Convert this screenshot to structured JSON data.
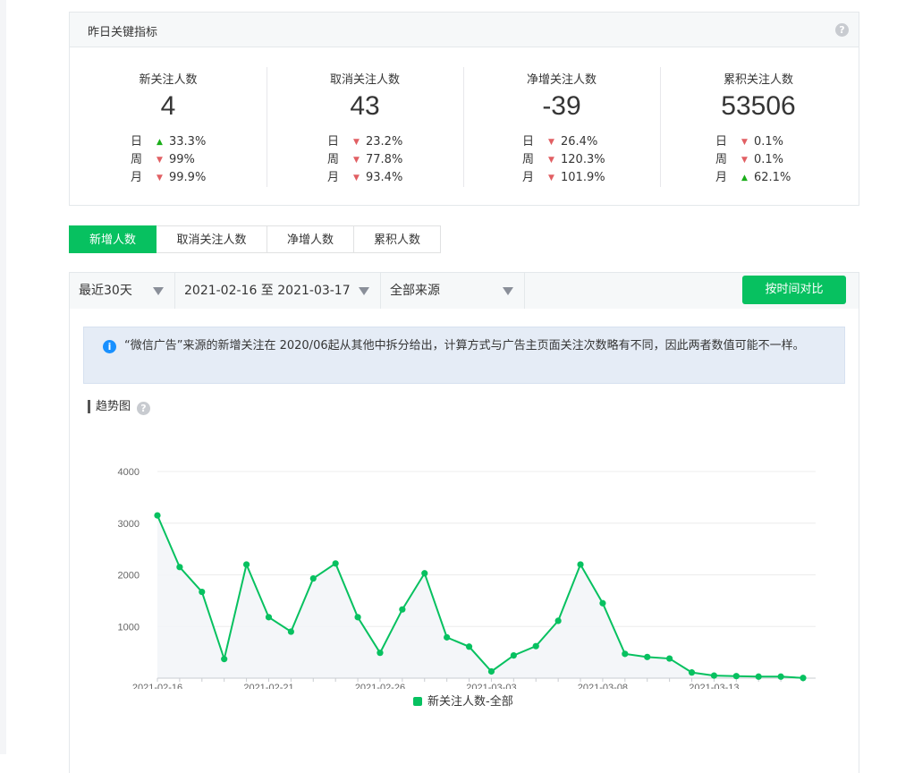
{
  "kpi_panel": {
    "title": "昨日关键指标",
    "help_icon": "?",
    "metrics": [
      {
        "label": "新关注人数",
        "value": "4",
        "rows": [
          {
            "period": "日",
            "dir": "up",
            "pct": "33.3%"
          },
          {
            "period": "周",
            "dir": "down",
            "pct": "99%"
          },
          {
            "period": "月",
            "dir": "down",
            "pct": "99.9%"
          }
        ]
      },
      {
        "label": "取消关注人数",
        "value": "43",
        "rows": [
          {
            "period": "日",
            "dir": "down",
            "pct": "23.2%"
          },
          {
            "period": "周",
            "dir": "down",
            "pct": "77.8%"
          },
          {
            "period": "月",
            "dir": "down",
            "pct": "93.4%"
          }
        ]
      },
      {
        "label": "净增关注人数",
        "value": "-39",
        "rows": [
          {
            "period": "日",
            "dir": "down",
            "pct": "26.4%"
          },
          {
            "period": "周",
            "dir": "down",
            "pct": "120.3%"
          },
          {
            "period": "月",
            "dir": "down",
            "pct": "101.9%"
          }
        ]
      },
      {
        "label": "累积关注人数",
        "value": "53506",
        "rows": [
          {
            "period": "日",
            "dir": "down",
            "pct": "0.1%"
          },
          {
            "period": "周",
            "dir": "down",
            "pct": "0.1%"
          },
          {
            "period": "月",
            "dir": "up",
            "pct": "62.1%"
          }
        ]
      }
    ]
  },
  "tabs": [
    "新增人数",
    "取消关注人数",
    "净增人数",
    "累积人数"
  ],
  "active_tab": 0,
  "filters": {
    "range": "最近30天",
    "dates": "2021-02-16 至 2021-03-17",
    "source": "全部来源",
    "compare_button": "按时间对比"
  },
  "notice": {
    "icon": "i",
    "text": "“微信广告”来源的新增关注在 2020/06起从其他中拆分给出，计算方式与广告主页面关注次数略有不同，因此两者数值可能不一样。"
  },
  "chart_section": {
    "title": "趋势图",
    "help_icon": "?"
  },
  "colors": {
    "accent": "#07c160",
    "up": "#1aad19",
    "down": "#e15f63"
  },
  "chart_data": {
    "type": "line",
    "x": [
      "2021-02-16",
      "2021-02-17",
      "2021-02-18",
      "2021-02-19",
      "2021-02-20",
      "2021-02-21",
      "2021-02-22",
      "2021-02-23",
      "2021-02-24",
      "2021-02-25",
      "2021-02-26",
      "2021-02-27",
      "2021-02-28",
      "2021-03-01",
      "2021-03-02",
      "2021-03-03",
      "2021-03-04",
      "2021-03-05",
      "2021-03-06",
      "2021-03-07",
      "2021-03-08",
      "2021-03-09",
      "2021-03-10",
      "2021-03-11",
      "2021-03-12",
      "2021-03-13",
      "2021-03-14",
      "2021-03-15",
      "2021-03-16",
      "2021-03-17"
    ],
    "x_ticks": [
      "2021-02-16",
      "2021-02-21",
      "2021-02-26",
      "2021-03-03",
      "2021-03-08",
      "2021-03-13"
    ],
    "y_ticks": [
      1000,
      2000,
      3000,
      4000
    ],
    "ylim": [
      0,
      4000
    ],
    "series": [
      {
        "name": "新关注人数-全部",
        "values": [
          3150,
          2150,
          1670,
          370,
          2200,
          1180,
          900,
          1930,
          2220,
          1180,
          490,
          1330,
          2030,
          790,
          610,
          130,
          440,
          620,
          1110,
          2200,
          1450,
          470,
          410,
          380,
          110,
          50,
          40,
          30,
          30,
          4
        ]
      }
    ],
    "grid": true,
    "legend": "bottom"
  }
}
